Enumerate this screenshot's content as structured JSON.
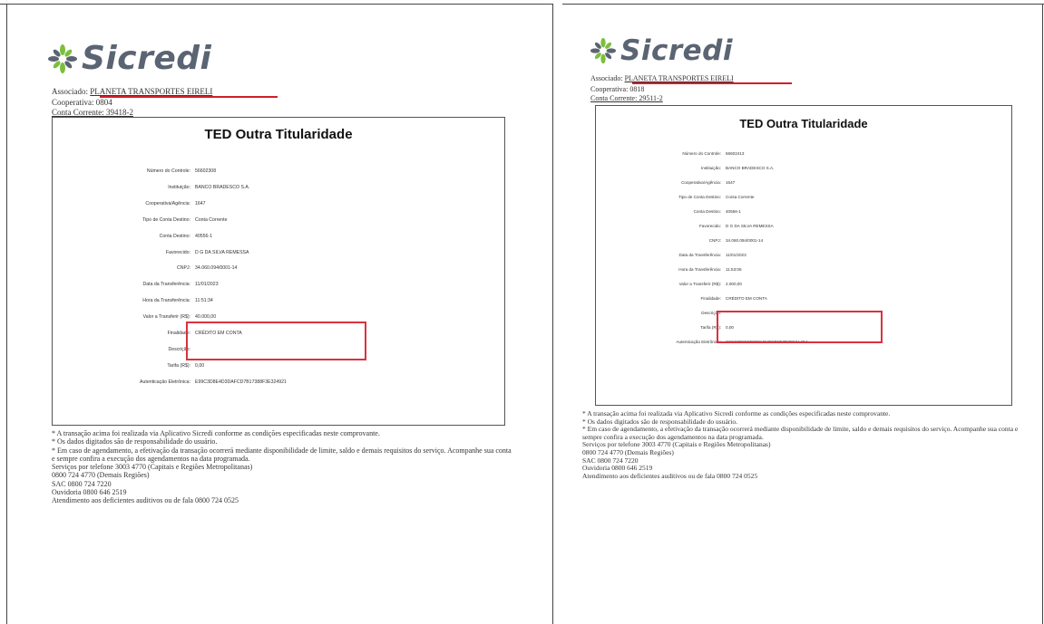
{
  "colors": {
    "accent_red": "#d01f2b",
    "logo_grey": "#5a6472",
    "logo_green": "#7bbf3c"
  },
  "documents": [
    {
      "logo_text": "Sicredi",
      "logo_icon": "sicredi-flower-icon",
      "associado_label": "Associado:",
      "associado_value": "PLANETA TRANSPORTES EIRELI",
      "cooperativa": "Cooperativa: 0804",
      "conta_corrente": "Conta Corrente: 39418-2",
      "title": "TED Outra Titularidade",
      "rows": [
        {
          "label": "Número do Controle:",
          "value": "56602308"
        },
        {
          "label": "Instituição:",
          "value": "BANCO BRADESCO S.A."
        },
        {
          "label": "Cooperativa/Agência:",
          "value": "1647"
        },
        {
          "label": "Tipo de Conta Destino:",
          "value": "Conta Corrente"
        },
        {
          "label": "Conta Destino:",
          "value": "40556-1"
        },
        {
          "label": "Favorecido:",
          "value": "D G DA SILVA REMESSA"
        },
        {
          "label": "CNPJ:",
          "value": "34.060.094/0001-14"
        },
        {
          "label": "Data da Transferência:",
          "value": "11/01/2023"
        },
        {
          "label": "Hora da Transferência:",
          "value": "11:51:34"
        },
        {
          "label": "Valor a Transferir (R$):",
          "value": "40.000,00"
        },
        {
          "label": "Finalidade:",
          "value": "CRÉDITO EM CONTA"
        },
        {
          "label": "Descrição:",
          "value": ""
        },
        {
          "label": "Tarifa (R$):",
          "value": "0,00"
        },
        {
          "label": "Autenticação Eletrônica:",
          "value": "E99C3D8E4D3DAFCD7B17388F3E324921"
        }
      ],
      "footer": [
        "* A transação acima foi realizada via Aplicativo Sicredi conforme as condições especificadas neste comprovante.",
        "* Os dados digitados são de responsabilidade do usuário.",
        "* Em caso de agendamento, a efetivação da transação ocorrerá mediante disponibilidade de limite, saldo e demais requisitos do serviço. Acompanhe sua conta e sempre confira a execução dos agendamentos na data programada.",
        "Serviços por telefone 3003 4770 (Capitais e Regiões Metropolitanas)",
        "0800 724 4770 (Demais Regiões)",
        "SAC 0800 724 7220",
        "Ouvidoria 0800 646 2519",
        "Atendimento aos deficientes auditivos ou de fala 0800 724 0525"
      ]
    },
    {
      "logo_text": "Sicredi",
      "logo_icon": "sicredi-flower-icon",
      "associado_label": "Associado:",
      "associado_value": "PLANETA TRANSPORTES EIRELI",
      "cooperativa": "Cooperativa: 0818",
      "conta_corrente": "Conta Corrente: 29511-2",
      "title": "TED Outra Titularidade",
      "rows": [
        {
          "label": "Número do Controle:",
          "value": "56602413"
        },
        {
          "label": "Instituição:",
          "value": "BANCO BRADESCO S.A."
        },
        {
          "label": "Cooperativa/Agência:",
          "value": "1647"
        },
        {
          "label": "Tipo de Conta Destino:",
          "value": "Conta Corrente"
        },
        {
          "label": "Conta Destino:",
          "value": "40556-1"
        },
        {
          "label": "Favorecido:",
          "value": "D G DA SILVA REMESSA"
        },
        {
          "label": "CNPJ:",
          "value": "34.060.094/0001-14"
        },
        {
          "label": "Data da Transferência:",
          "value": "11/01/2023"
        },
        {
          "label": "Hora da Transferência:",
          "value": "11:53:06"
        },
        {
          "label": "Valor a Transferir (R$):",
          "value": "2.000,00"
        },
        {
          "label": "Finalidade:",
          "value": "CRÉDITO EM CONTA"
        },
        {
          "label": "Descrição:",
          "value": ""
        },
        {
          "label": "Tarifa (R$):",
          "value": "0,00"
        },
        {
          "label": "Autenticação Eletrônica:",
          "value": "C9CC9D5E8099E94E2E5D8E3D3E53A4F4"
        }
      ],
      "footer": [
        "* A transação acima foi realizada via Aplicativo Sicredi conforme as condições especificadas neste comprovante.",
        "* Os dados digitados são de responsabilidade do usuário.",
        "* Em caso de agendamento, a efetivação da transação ocorrerá mediante disponibilidade de limite, saldo e demais requisitos do serviço. Acompanhe sua conta e sempre confira a execução dos agendamentos na data programada.",
        "Serviços por telefone 3003 4770 (Capitais e Regiões Metropolitanas)",
        "0800 724 4770 (Demais Regiões)",
        "SAC 0800 724 7220",
        "Ouvidoria 0800 646 2519",
        "Atendimento aos deficientes auditivos ou de fala 0800 724 0525"
      ]
    }
  ]
}
